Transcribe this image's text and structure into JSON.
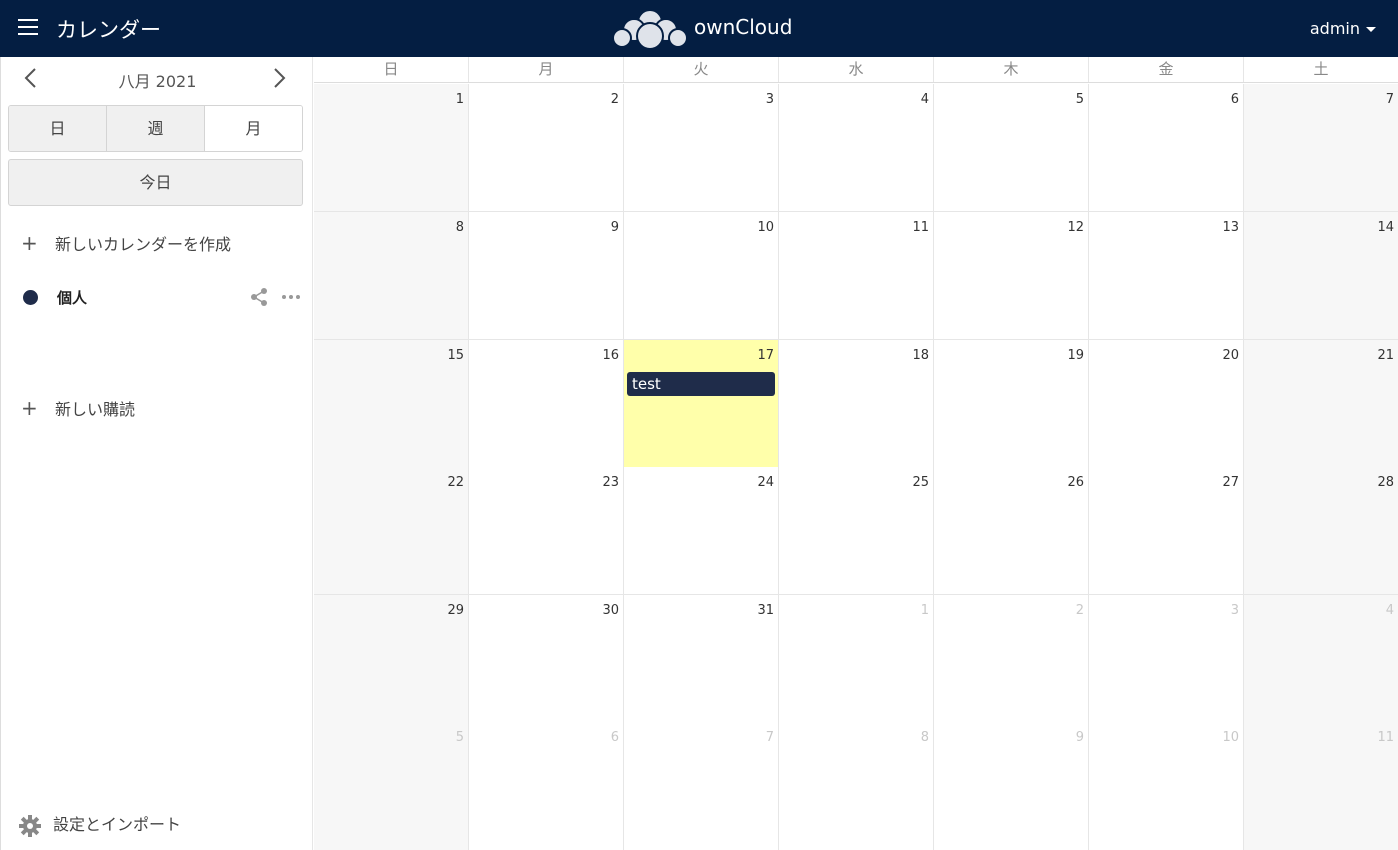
{
  "header": {
    "app_title": "カレンダー",
    "brand": "ownCloud",
    "user": "admin",
    "background": "#041e42"
  },
  "sidebar": {
    "month_label": "八月 2021",
    "views": [
      "日",
      "週",
      "月"
    ],
    "today_label": "今日",
    "new_calendar_label": "新しいカレンダーを作成",
    "calendars": [
      {
        "name": "個人",
        "color": "#1f2c4a"
      }
    ],
    "new_subscription_label": "新しい購読",
    "settings_label": "設定とインポート"
  },
  "calendar": {
    "weekdays": [
      "日",
      "月",
      "火",
      "水",
      "木",
      "金",
      "土"
    ],
    "weeks": [
      [
        "1",
        "2",
        "3",
        "4",
        "5",
        "6",
        "7"
      ],
      [
        "8",
        "9",
        "10",
        "11",
        "12",
        "13",
        "14"
      ],
      [
        "15",
        "16",
        "17",
        "18",
        "19",
        "20",
        "21"
      ],
      [
        "22",
        "23",
        "24",
        "25",
        "26",
        "27",
        "28"
      ],
      [
        "29",
        "30",
        "31",
        "1",
        "2",
        "3",
        "4"
      ],
      [
        "5",
        "6",
        "7",
        "8",
        "9",
        "10",
        "11"
      ]
    ],
    "event": {
      "title": "test",
      "date": "17"
    },
    "today_color": "#ffffaa"
  }
}
